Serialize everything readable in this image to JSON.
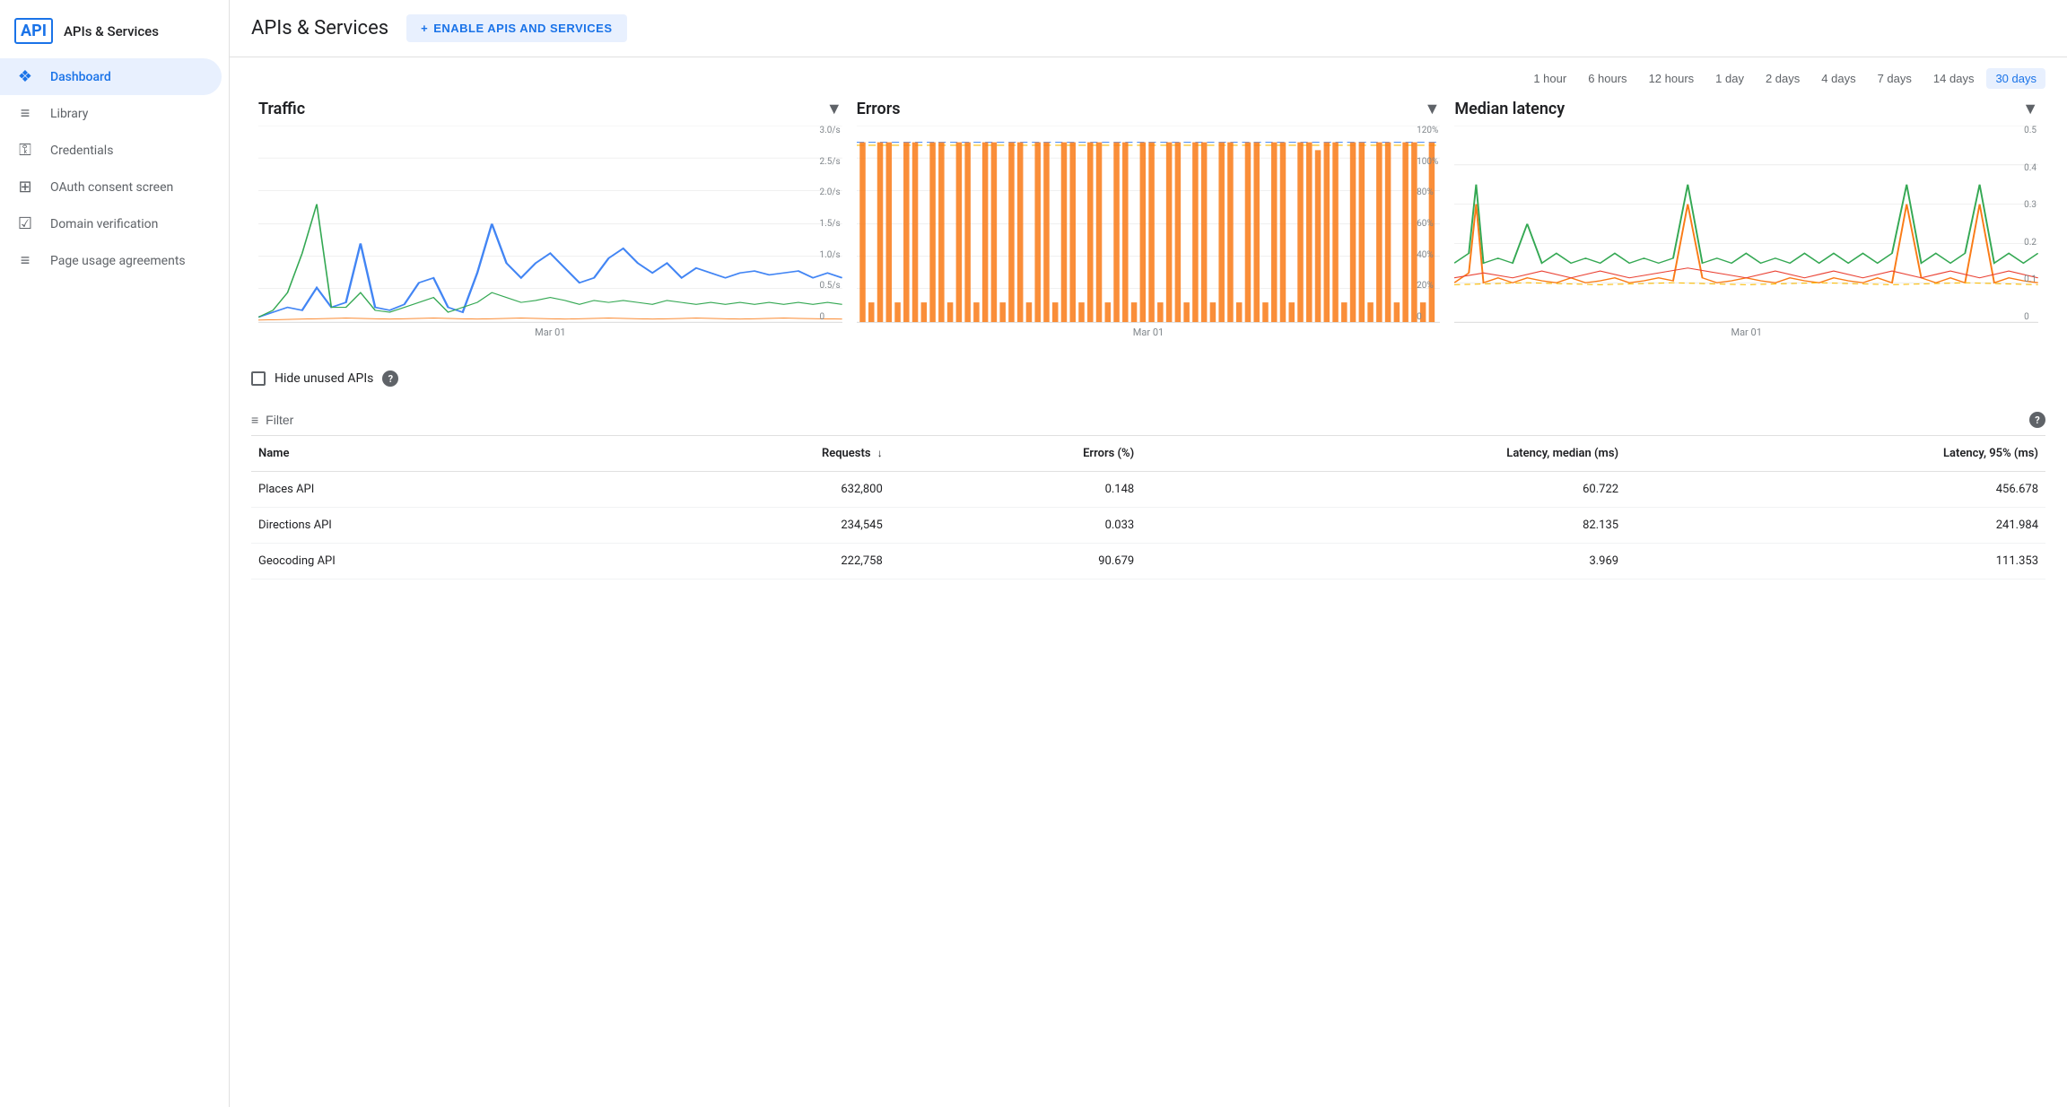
{
  "sidebar": {
    "logo": "API",
    "title": "APIs & Services",
    "items": [
      {
        "id": "dashboard",
        "label": "Dashboard",
        "icon": "❖",
        "active": true
      },
      {
        "id": "library",
        "label": "Library",
        "icon": "≡",
        "active": false
      },
      {
        "id": "credentials",
        "label": "Credentials",
        "icon": "⚿",
        "active": false
      },
      {
        "id": "oauth",
        "label": "OAuth consent screen",
        "icon": "⊞",
        "active": false
      },
      {
        "id": "domain",
        "label": "Domain verification",
        "icon": "☑",
        "active": false
      },
      {
        "id": "pageusage",
        "label": "Page usage agreements",
        "icon": "≡",
        "active": false
      }
    ]
  },
  "header": {
    "title": "APIs & Services",
    "enable_button": "ENABLE APIS AND SERVICES",
    "enable_plus": "+"
  },
  "time_selector": {
    "options": [
      {
        "label": "1 hour",
        "active": false
      },
      {
        "label": "6 hours",
        "active": false
      },
      {
        "label": "12 hours",
        "active": false
      },
      {
        "label": "1 day",
        "active": false
      },
      {
        "label": "2 days",
        "active": false
      },
      {
        "label": "4 days",
        "active": false
      },
      {
        "label": "7 days",
        "active": false
      },
      {
        "label": "14 days",
        "active": false
      },
      {
        "label": "30 days",
        "active": true
      }
    ]
  },
  "charts": {
    "traffic": {
      "title": "Traffic",
      "x_label": "Mar 01",
      "y_labels": [
        "3.0/s",
        "2.5/s",
        "2.0/s",
        "1.5/s",
        "1.0/s",
        "0.5/s",
        "0"
      ]
    },
    "errors": {
      "title": "Errors",
      "x_label": "Mar 01",
      "y_labels": [
        "120%",
        "100%",
        "80%",
        "60%",
        "40%",
        "20%",
        "0"
      ]
    },
    "latency": {
      "title": "Median latency",
      "x_label": "Mar 01",
      "y_labels": [
        "0.5",
        "0.4",
        "0.3",
        "0.2",
        "0.1",
        "0"
      ]
    }
  },
  "hide_unused": {
    "label": "Hide unused APIs"
  },
  "table": {
    "filter_label": "Filter",
    "help_icon": "?",
    "columns": [
      "Name",
      "Requests",
      "Errors (%)",
      "Latency, median (ms)",
      "Latency, 95% (ms)"
    ],
    "rows": [
      {
        "name": "Places API",
        "requests": "632,800",
        "errors": "0.148",
        "latency_median": "60.722",
        "latency_95": "456.678"
      },
      {
        "name": "Directions API",
        "requests": "234,545",
        "errors": "0.033",
        "latency_median": "82.135",
        "latency_95": "241.984"
      },
      {
        "name": "Geocoding API",
        "requests": "222,758",
        "errors": "90.679",
        "latency_median": "3.969",
        "latency_95": "111.353"
      }
    ]
  },
  "colors": {
    "blue": "#1a73e8",
    "active_bg": "#e8f0fe",
    "orange": "#fa7b17",
    "green": "#34a853",
    "red": "#ea4335",
    "dashed_blue": "#4285f4",
    "dashed_orange": "#fbbc04"
  }
}
